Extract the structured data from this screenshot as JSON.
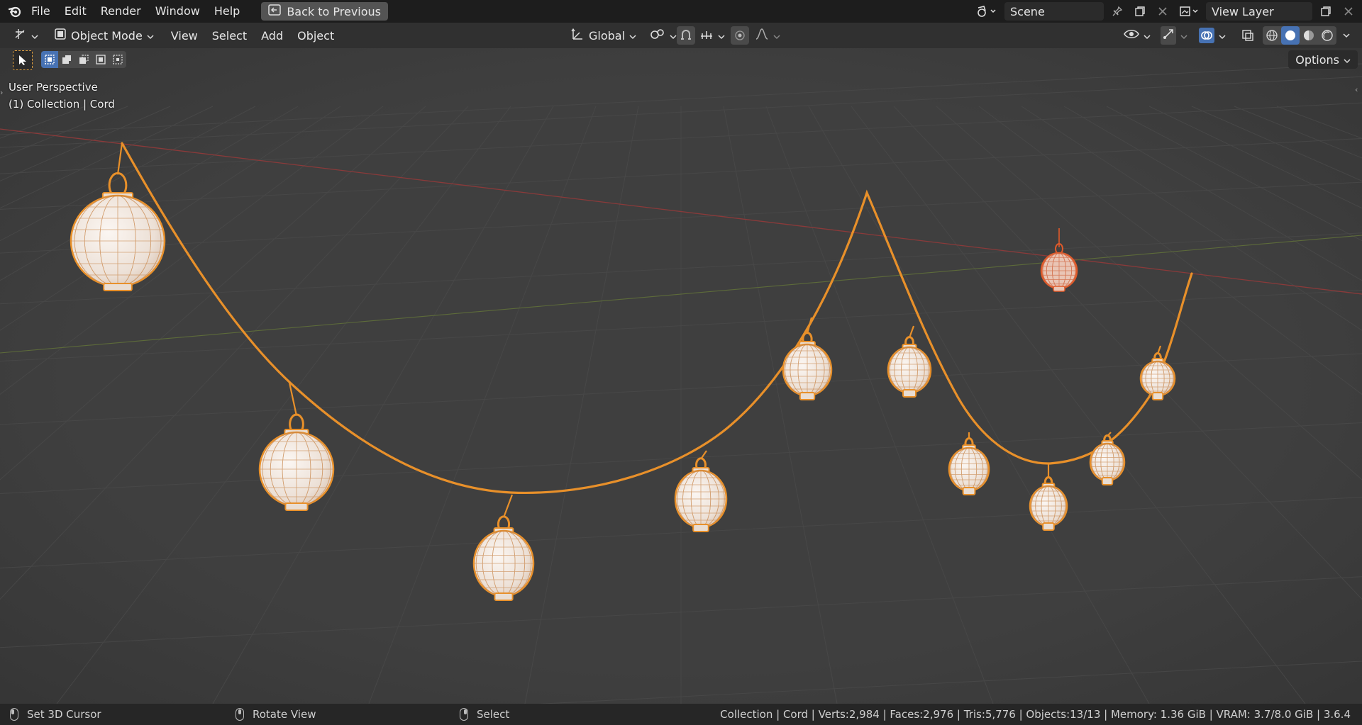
{
  "topbar": {
    "menus": [
      "File",
      "Edit",
      "Render",
      "Window",
      "Help"
    ],
    "back_label": "Back to Previous",
    "scene_name": "Scene",
    "view_layer_name": "View Layer"
  },
  "header": {
    "mode_label": "Object Mode",
    "menus": [
      "View",
      "Select",
      "Add",
      "Object"
    ],
    "transform_orientation": "Global"
  },
  "toolrow": {
    "options_label": "Options"
  },
  "viewport": {
    "view_name": "User Perspective",
    "context": "(1) Collection | Cord"
  },
  "statusbar": {
    "hint_left": "Set 3D Cursor",
    "hint_middle": "Rotate View",
    "hint_right": "Select",
    "stats": "Collection | Cord | Verts:2,984 | Faces:2,976 | Tris:5,776 | Objects:13/13 | Memory: 1.36 GiB | VRAM: 3.7/8.0 GiB | 3.6.4"
  },
  "colors": {
    "selection_orange": "#e8902a",
    "active_highlight": "#4772b3",
    "lantern_fill": "#f4ece6",
    "lantern_wire": "#c9894f",
    "red_lantern_outline": "#e05a2a"
  }
}
